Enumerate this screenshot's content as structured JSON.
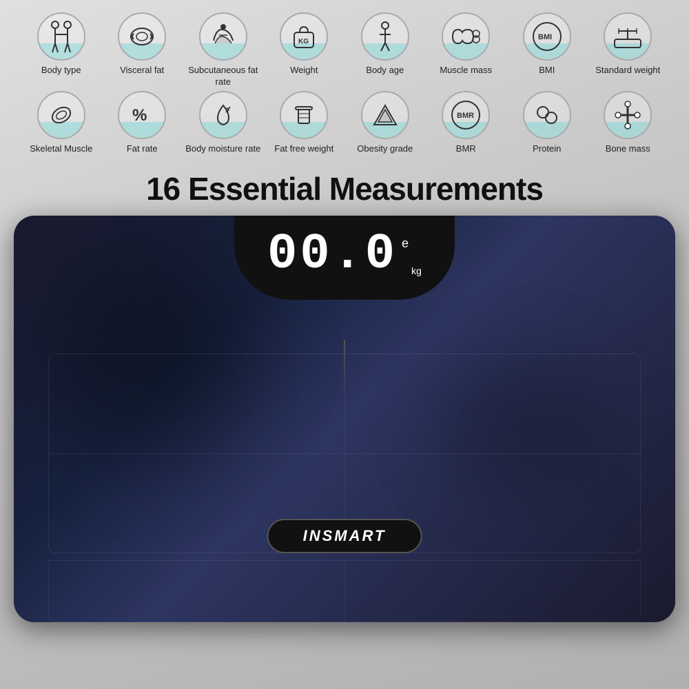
{
  "heading": {
    "title": "16 Essential Measurements"
  },
  "brand": {
    "name": "INSMART"
  },
  "display": {
    "digits": "00.0",
    "superscript": "e",
    "unit": "kg"
  },
  "row1": [
    {
      "id": "body-type",
      "label": "Body type"
    },
    {
      "id": "visceral-fat",
      "label": "Visceral fat"
    },
    {
      "id": "subcutaneous-fat-rate",
      "label": "Subcutaneous\nfat rate"
    },
    {
      "id": "weight",
      "label": "Weight"
    },
    {
      "id": "body-age",
      "label": "Body age"
    },
    {
      "id": "muscle-mass",
      "label": "Muscle mass"
    },
    {
      "id": "bmi",
      "label": "BMI"
    },
    {
      "id": "standard-weight",
      "label": "Standard weight"
    }
  ],
  "row2": [
    {
      "id": "skeletal-muscle",
      "label": "Skeletal Muscle"
    },
    {
      "id": "fat-rate",
      "label": "Fat rate"
    },
    {
      "id": "body-moisture-rate",
      "label": "Body moisture\nrate"
    },
    {
      "id": "fat-free-weight",
      "label": "Fat free\nweight"
    },
    {
      "id": "obesity-grade",
      "label": "Obesity grade"
    },
    {
      "id": "bmr",
      "label": "BMR"
    },
    {
      "id": "protein",
      "label": "Protein"
    },
    {
      "id": "bone-mass",
      "label": "Bone mass"
    }
  ]
}
